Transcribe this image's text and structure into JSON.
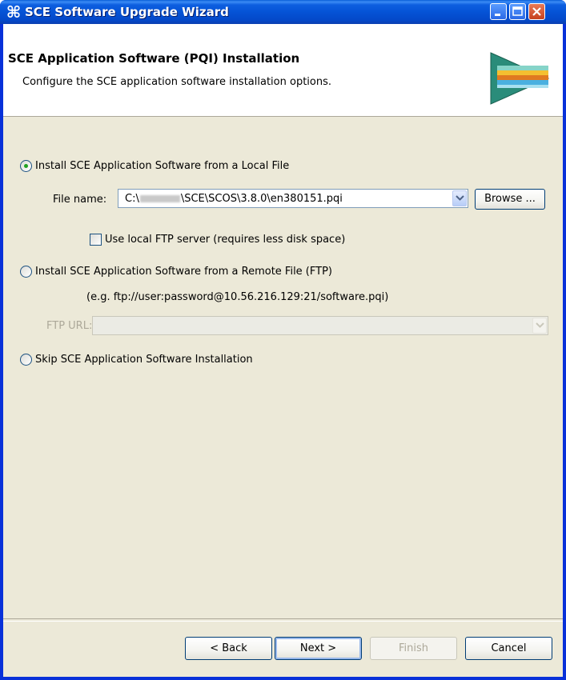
{
  "window": {
    "title": "SCE Software Upgrade Wizard",
    "icon": "cisco-command-icon"
  },
  "header": {
    "title": "SCE Application Software (PQI) Installation",
    "subtitle": "Configure the SCE application software installation options."
  },
  "options": {
    "local_file": {
      "label": "Install SCE Application Software from a Local File",
      "selected": true,
      "file_name_label": "File name:",
      "file_name_prefix": "C:\\",
      "file_name_suffix": "\\SCE\\SCOS\\3.8.0\\en380151.pqi",
      "browse_label": "Browse ...",
      "use_ftp_label": "Use local FTP server (requires less disk space)"
    },
    "remote_file": {
      "label": "Install SCE Application Software from a Remote File (FTP)",
      "selected": false,
      "example": "(e.g. ftp://user:password@10.56.216.129:21/software.pqi)",
      "ftp_url_label": "FTP URL:",
      "ftp_url_value": ""
    },
    "skip": {
      "label": "Skip SCE Application Software Installation",
      "selected": false
    }
  },
  "footer": {
    "back": "< Back",
    "next": "Next >",
    "finish": "Finish",
    "cancel": "Cancel"
  },
  "colors": {
    "titlebar": "#0553d6",
    "dialog_bg": "#ece9d8",
    "header_bg": "#ffffff",
    "disabled_text": "#aca899"
  }
}
